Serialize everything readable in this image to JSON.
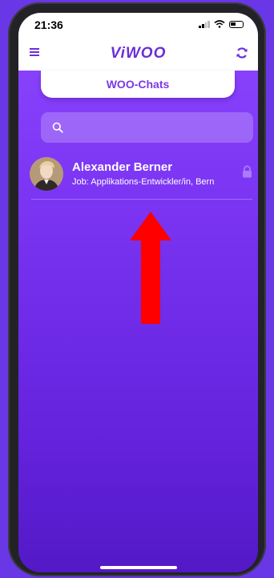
{
  "status_bar": {
    "time": "21:36"
  },
  "nav": {
    "brand": "ViWOO",
    "menu_icon": "hamburger-icon",
    "refresh_icon": "refresh-icon"
  },
  "tab": {
    "label": "WOO-Chats"
  },
  "search": {
    "placeholder": "",
    "icon": "search-icon"
  },
  "chats": [
    {
      "name": "Alexander Berner",
      "subtitle": "Job: Applikations-Entwickler/in, Bern",
      "locked": true
    }
  ],
  "annotation": {
    "type": "arrow-up",
    "color": "#ff0000"
  },
  "colors": {
    "background": "#6a37e6",
    "brand": "#6a2ed8",
    "screen_top": "#8d46ff",
    "screen_bottom": "#5319c6",
    "arrow": "#ff0000"
  }
}
